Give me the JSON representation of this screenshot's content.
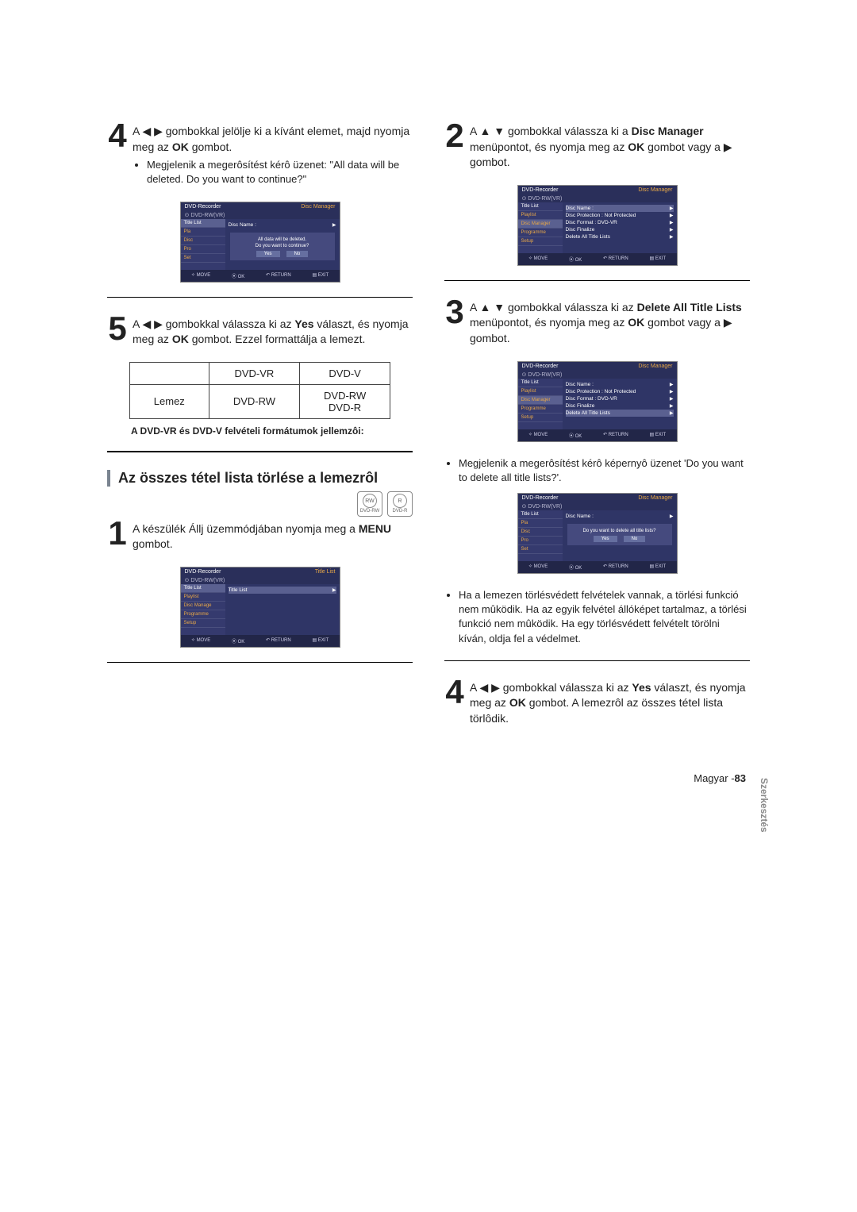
{
  "left": {
    "step4": {
      "num": "4",
      "text_a": "A ◀ ▶ gombokkal jelölje ki a kívánt elemet, majd nyomja meg az ",
      "ok": "OK",
      "text_b": " gombot.",
      "bullet": "Megjelenik a megerôsítést kérô üzenet: \"All data will be deleted. Do you want to continue?\""
    },
    "step5": {
      "num": "5",
      "text_a": "A ◀ ▶ gombokkal válassza ki az ",
      "yes": "Yes",
      "text_b": " választ, és nyomja meg az ",
      "ok": "OK",
      "text_c": " gombot. Ezzel formattálja a lemezt."
    },
    "table": {
      "h1": "DVD-VR",
      "h2": "DVD-V",
      "r1c0": "Lemez",
      "r1c1": "DVD-RW",
      "r1c2a": "DVD-RW",
      "r1c2b": "DVD-R"
    },
    "caption": "A DVD-VR és DVD-V felvételi formátumok jellemzôi:",
    "section": "Az összes tétel lista törlése a lemezrôl",
    "disc1": "DVD-RW",
    "disc2": "DVD-R",
    "step1": {
      "num": "1",
      "text_a": "A készülék Állj üzemmódjában nyomja meg a ",
      "menu": "MENU",
      "text_b": " gombot."
    }
  },
  "right": {
    "step2": {
      "num": "2",
      "text_a": "A ▲ ▼ gombokkal válassza ki a ",
      "dm": "Disc Manager",
      "text_b": " menüpontot, és nyomja meg az ",
      "ok": "OK",
      "text_c": " gombot vagy a ▶ gombot."
    },
    "step3": {
      "num": "3",
      "text_a": "A ▲ ▼ gombokkal válassza ki az ",
      "del": "Delete All Title Lists",
      "text_b": " menüpontot, és nyomja meg az ",
      "ok": "OK",
      "text_c": " gombot vagy a ▶ gombot.",
      "bullet": "Megjelenik a megerôsítést kérô képernyô üzenet 'Do you want to delete all title lists?'.",
      "bullet2": "Ha a lemezen törlésvédett felvételek vannak, a törlési funkció nem mûködik. Ha az egyik felvétel állóképet tartalmaz, a törlési funkció nem mûködik. Ha egy törlésvédett felvételt törölni kíván, oldja fel a védelmet."
    },
    "step4": {
      "num": "4",
      "text_a": "A ◀ ▶ gombokkal válassza ki az ",
      "yes": "Yes",
      "text_b": " választ, és nyomja meg az ",
      "ok": "OK",
      "text_c": " gombot. A lemezrôl az összes tétel lista törlôdik."
    }
  },
  "osd": {
    "title": "DVD-Recorder",
    "mode_dm": "Disc Manager",
    "mode_tl": "Title List",
    "sub": "DVD-RW(VR)",
    "side": {
      "tl": "Title List",
      "pl": "Playlist",
      "dm": "Disc Manager",
      "pg": "Programme",
      "su": "Setup",
      "set": "Set"
    },
    "rows": {
      "name": "Disc Name :",
      "prot": "Disc Protection : Not Protected",
      "fmt": "Disc Format       : DVD-VR",
      "fin": "Disc Finalize",
      "del": "Delete All Title Lists"
    },
    "pop1": {
      "l1": "All data will be deleted.",
      "l2": "Do you want to continue?"
    },
    "pop2": "Do you want to delete all title lists?",
    "yes": "Yes",
    "no": "No",
    "ftr": {
      "move": "MOVE",
      "ok": "OK",
      "ret": "RETURN",
      "exit": "EXIT"
    }
  },
  "sidetab": "Szerkesztés",
  "pagenum_a": "Magyar -",
  "pagenum_b": "83"
}
